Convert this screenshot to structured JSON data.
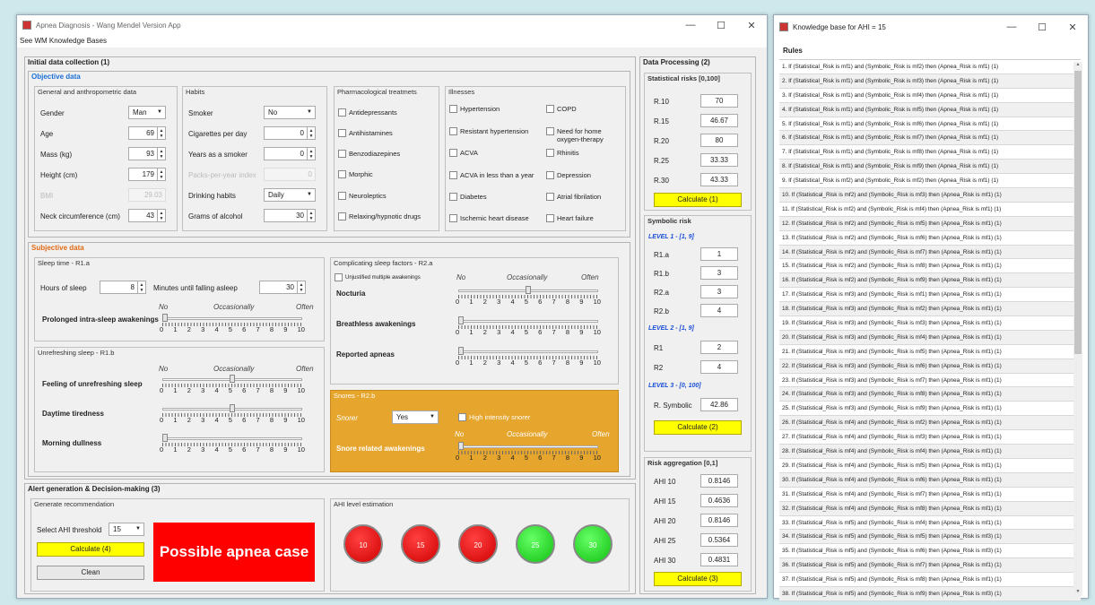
{
  "main_window": {
    "title": "Apnea Diagnosis - Wang Mendel Version App",
    "menu": "See WM Knowledge Bases",
    "min": "—",
    "max": "☐",
    "close": "✕"
  },
  "initial": {
    "title": "Initial data collection (1)",
    "objective_title": "Objective data",
    "general": {
      "title": "General and anthropometric data",
      "gender_label": "Gender",
      "gender_value": "Man",
      "age_label": "Age",
      "age_value": "69",
      "mass_label": "Mass (kg)",
      "mass_value": "93",
      "height_label": "Height (cm)",
      "height_value": "179",
      "bmi_label": "BMI",
      "bmi_value": "29.03",
      "neck_label": "Neck circumference (cm)",
      "neck_value": "43"
    },
    "habits": {
      "title": "Habits",
      "smoker_label": "Smoker",
      "smoker_value": "No",
      "cig_label": "Cigarettes per day",
      "cig_value": "0",
      "years_label": "Years as a smoker",
      "years_value": "0",
      "packs_label": "Packs-per-year index",
      "packs_value": "0",
      "drinking_label": "Drinking habits",
      "drinking_value": "Daily",
      "alcohol_label": "Grams of alcohol",
      "alcohol_value": "30"
    },
    "pharma": {
      "title": "Pharmacological treatmets",
      "items": [
        "Antidepressants",
        "Antihistamines",
        "Benzodiazepines",
        "Morphic",
        "Neuroleptics",
        "Relaxing/hypnotic drugs"
      ]
    },
    "illnesses": {
      "title": "Illnesses",
      "left": [
        "Hypertension",
        "Resistant hypertension",
        "ACVA",
        "ACVA in less than a year",
        "Diabetes",
        "Ischemic heart disease"
      ],
      "right": [
        "COPD",
        "Need for home oxygen-therapy",
        "Rhinitis",
        "Depression",
        "Atrial fibrilation",
        "Heart failure"
      ]
    },
    "subjective_title": "Subjective data",
    "sleep_time": {
      "title": "Sleep time - R1.a",
      "hours_label": "Hours of sleep",
      "hours_value": "8",
      "minutes_label": "Minutes until falling asleep",
      "minutes_value": "30",
      "prolonged_label": "Prolonged intra-sleep awakenings",
      "prolonged_level": 0
    },
    "unrefreshing": {
      "title": "Unrefreshing sleep - R1.b",
      "feeling_label": "Feeling of unrefreshing sleep",
      "feeling_level": 5,
      "daytime_label": "Daytime tiredness",
      "daytime_level": 5,
      "morning_label": "Morning dullness",
      "morning_level": 0
    },
    "complicating": {
      "title": "Complicating sleep factors - R2.a",
      "unjustified_label": "Unjustified multiple awakenings",
      "nocturia_label": "Nocturia",
      "nocturia_level": 5,
      "breathless_label": "Breathless awakenings",
      "breathless_level": 0,
      "apneas_label": "Reported apneas",
      "apneas_level": 0
    },
    "snores": {
      "title": "Snores - R2.b",
      "snorer_label": "Snorer",
      "snorer_value": "Yes",
      "high_label": "High intensity snorer",
      "awakenings_label": "Snore related awakenings",
      "awakenings_level": 0
    },
    "scale": {
      "no": "No",
      "occ": "Occasionally",
      "often": "Often",
      "nums": [
        "0",
        "1",
        "2",
        "3",
        "4",
        "5",
        "6",
        "7",
        "8",
        "9",
        "10"
      ]
    }
  },
  "processing": {
    "title": "Data Processing (2)",
    "stat_title": "Statistical risks [0,100]",
    "stat": [
      {
        "label": "R.10",
        "value": "70"
      },
      {
        "label": "R.15",
        "value": "46.67"
      },
      {
        "label": "R.20",
        "value": "80"
      },
      {
        "label": "R.25",
        "value": "33.33"
      },
      {
        "label": "R.30",
        "value": "43.33"
      }
    ],
    "calc1": "Calculate (1)",
    "sym_title": "Symbolic risk",
    "level1": "LEVEL 1 - [1, 9]",
    "l1": [
      {
        "label": "R1.a",
        "value": "1"
      },
      {
        "label": "R1.b",
        "value": "3"
      },
      {
        "label": "R2.a",
        "value": "3"
      },
      {
        "label": "R2.b",
        "value": "4"
      }
    ],
    "level2": "LEVEL 2 - [1, 9]",
    "l2": [
      {
        "label": "R1",
        "value": "2"
      },
      {
        "label": "R2",
        "value": "4"
      }
    ],
    "level3": "LEVEL 3 - [0, 100]",
    "rsym_label": "R. Symbolic",
    "rsym_value": "42.86",
    "calc2": "Calculate (2)",
    "agg_title": "Risk aggregation [0,1]",
    "agg": [
      {
        "label": "AHI 10",
        "value": "0.8146"
      },
      {
        "label": "AHI 15",
        "value": "0.4636"
      },
      {
        "label": "AHI 20",
        "value": "0.8146"
      },
      {
        "label": "AHI 25",
        "value": "0.5364"
      },
      {
        "label": "AHI 30",
        "value": "0.4831"
      }
    ],
    "calc3": "Calculate (3)"
  },
  "alert": {
    "title": "Alert generation & Decision-making (3)",
    "rec_title": "Generate recommendation",
    "threshold_label": "Select AHI threshold",
    "threshold_value": "15",
    "calc4": "Calculate (4)",
    "clean": "Clean",
    "result": "Possible apnea case",
    "result_color": "#ff0000",
    "ahi_title": "AHI level estimation",
    "levels": [
      {
        "label": "10",
        "status": "red"
      },
      {
        "label": "15",
        "status": "red"
      },
      {
        "label": "20",
        "status": "red"
      },
      {
        "label": "25",
        "status": "green"
      },
      {
        "label": "30",
        "status": "green"
      }
    ]
  },
  "kb_window": {
    "title": "Knowledge base for AHI = 15",
    "min": "—",
    "max": "☐",
    "close": "✕",
    "header": "Rules",
    "rules": [
      "1. If (Statistical_Risk is mf1) and (Symbolic_Risk is mf2) then (Apnea_Risk is mf1) (1)",
      "2. If (Statistical_Risk is mf1) and (Symbolic_Risk is mf3) then (Apnea_Risk is mf1) (1)",
      "3. If (Statistical_Risk is mf1) and (Symbolic_Risk is mf4) then (Apnea_Risk is mf1) (1)",
      "4. If (Statistical_Risk is mf1) and (Symbolic_Risk is mf5) then (Apnea_Risk is mf1) (1)",
      "5. If (Statistical_Risk is mf1) and (Symbolic_Risk is mf6) then (Apnea_Risk is mf1) (1)",
      "6. If (Statistical_Risk is mf1) and (Symbolic_Risk is mf7) then (Apnea_Risk is mf1) (1)",
      "7. If (Statistical_Risk is mf1) and (Symbolic_Risk is mf8) then (Apnea_Risk is mf1) (1)",
      "8. If (Statistical_Risk is mf1) and (Symbolic_Risk is mf9) then (Apnea_Risk is mf1) (1)",
      "9. If (Statistical_Risk is mf2) and (Symbolic_Risk is mf2) then (Apnea_Risk is mf1) (1)",
      "10. If (Statistical_Risk is mf2) and (Symbolic_Risk is mf3) then (Apnea_Risk is mf1) (1)",
      "11. If (Statistical_Risk is mf2) and (Symbolic_Risk is mf4) then (Apnea_Risk is mf1) (1)",
      "12. If (Statistical_Risk is mf2) and (Symbolic_Risk is mf5) then (Apnea_Risk is mf1) (1)",
      "13. If (Statistical_Risk is mf2) and (Symbolic_Risk is mf6) then (Apnea_Risk is mf1) (1)",
      "14. If (Statistical_Risk is mf2) and (Symbolic_Risk is mf7) then (Apnea_Risk is mf1) (1)",
      "15. If (Statistical_Risk is mf2) and (Symbolic_Risk is mf8) then (Apnea_Risk is mf1) (1)",
      "16. If (Statistical_Risk is mf2) and (Symbolic_Risk is mf9) then (Apnea_Risk is mf1) (1)",
      "17. If (Statistical_Risk is mf3) and (Symbolic_Risk is mf1) then (Apnea_Risk is mf1) (1)",
      "18. If (Statistical_Risk is mf3) and (Symbolic_Risk is mf2) then (Apnea_Risk is mf1) (1)",
      "19. If (Statistical_Risk is mf3) and (Symbolic_Risk is mf3) then (Apnea_Risk is mf1) (1)",
      "20. If (Statistical_Risk is mf3) and (Symbolic_Risk is mf4) then (Apnea_Risk is mf1) (1)",
      "21. If (Statistical_Risk is mf3) and (Symbolic_Risk is mf5) then (Apnea_Risk is mf1) (1)",
      "22. If (Statistical_Risk is mf3) and (Symbolic_Risk is mf6) then (Apnea_Risk is mf1) (1)",
      "23. If (Statistical_Risk is mf3) and (Symbolic_Risk is mf7) then (Apnea_Risk is mf1) (1)",
      "24. If (Statistical_Risk is mf3) and (Symbolic_Risk is mf8) then (Apnea_Risk is mf1) (1)",
      "25. If (Statistical_Risk is mf3) and (Symbolic_Risk is mf9) then (Apnea_Risk is mf1) (1)",
      "26. If (Statistical_Risk is mf4) and (Symbolic_Risk is mf2) then (Apnea_Risk is mf1) (1)",
      "27. If (Statistical_Risk is mf4) and (Symbolic_Risk is mf3) then (Apnea_Risk is mf1) (1)",
      "28. If (Statistical_Risk is mf4) and (Symbolic_Risk is mf4) then (Apnea_Risk is mf1) (1)",
      "29. If (Statistical_Risk is mf4) and (Symbolic_Risk is mf5) then (Apnea_Risk is mf1) (1)",
      "30. If (Statistical_Risk is mf4) and (Symbolic_Risk is mf6) then (Apnea_Risk is mf1) (1)",
      "31. If (Statistical_Risk is mf4) and (Symbolic_Risk is mf7) then (Apnea_Risk is mf1) (1)",
      "32. If (Statistical_Risk is mf4) and (Symbolic_Risk is mf8) then (Apnea_Risk is mf1) (1)",
      "33. If (Statistical_Risk is mf5) and (Symbolic_Risk is mf4) then (Apnea_Risk is mf1) (1)",
      "34. If (Statistical_Risk is mf5) and (Symbolic_Risk is mf5) then (Apnea_Risk is mf3) (1)",
      "35. If (Statistical_Risk is mf5) and (Symbolic_Risk is mf6) then (Apnea_Risk is mf3) (1)",
      "36. If (Statistical_Risk is mf5) and (Symbolic_Risk is mf7) then (Apnea_Risk is mf1) (1)",
      "37. If (Statistical_Risk is mf5) and (Symbolic_Risk is mf8) then (Apnea_Risk is mf1) (1)",
      "38. If (Statistical_Risk is mf5) and (Symbolic_Risk is mf9) then (Apnea_Risk is mf3) (1)"
    ]
  }
}
